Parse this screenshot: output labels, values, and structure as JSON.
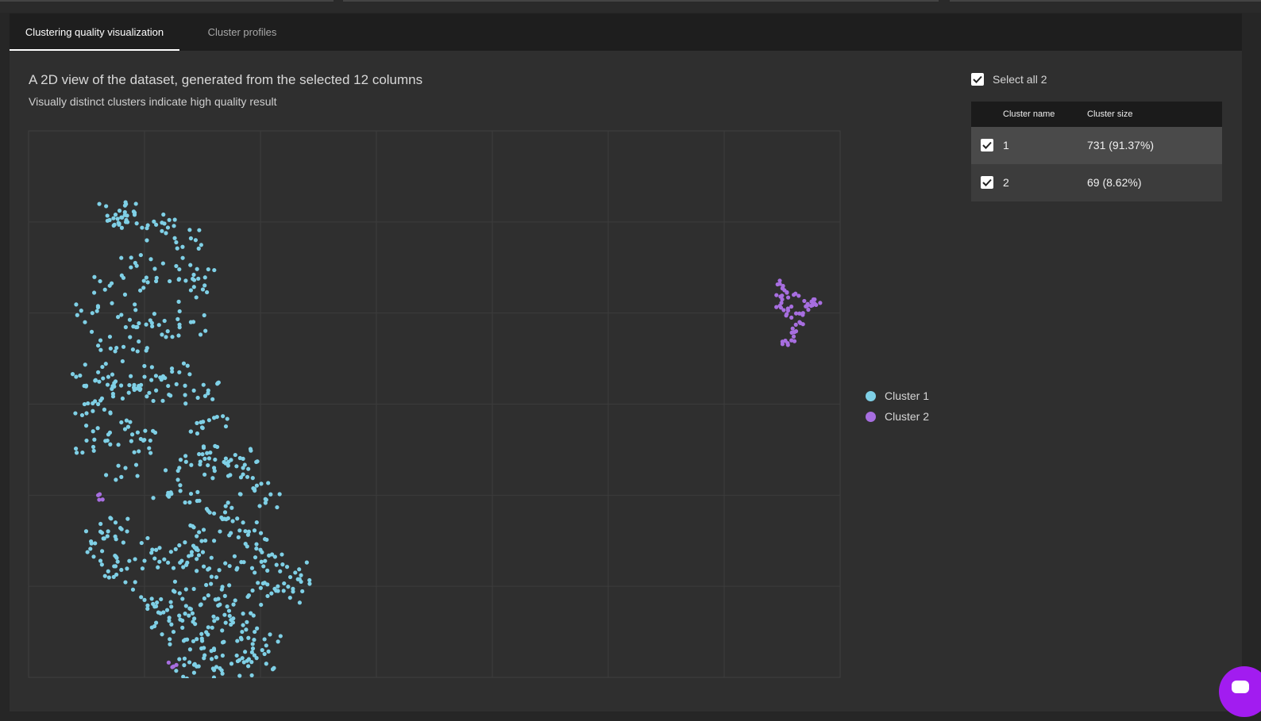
{
  "tabs": [
    {
      "label": "Clustering quality visualization",
      "active": true
    },
    {
      "label": "Cluster profiles",
      "active": false
    }
  ],
  "heading": "A 2D view of the dataset, generated from the selected 12 columns",
  "subheading": "Visually distinct clusters indicate high quality result",
  "legend": [
    {
      "label": "Cluster 1",
      "color": "#7fd0e6"
    },
    {
      "label": "Cluster 2",
      "color": "#a76ee0"
    }
  ],
  "select_all": {
    "label": "Select all 2",
    "checked": true
  },
  "cluster_table": {
    "headers": [
      "Cluster name",
      "Cluster size"
    ],
    "rows": [
      {
        "name": "1",
        "size": "731 (91.37%)",
        "checked": true
      },
      {
        "name": "2",
        "size": "69 (8.62%)",
        "checked": true
      }
    ]
  },
  "chart_data": {
    "type": "scatter",
    "grid": true,
    "xlim": [
      0,
      7
    ],
    "ylim": [
      0,
      6
    ],
    "series": [
      {
        "name": "Cluster 1",
        "color": "#7fd0e6",
        "count": 731,
        "points": [
          [
            0.75,
            5.08
          ],
          [
            0.8,
            5.05
          ],
          [
            0.85,
            5.07
          ],
          [
            0.78,
            4.97
          ],
          [
            1.1,
            4.97
          ],
          [
            1.15,
            4.9
          ],
          [
            1.4,
            4.82
          ],
          [
            0.92,
            4.55
          ],
          [
            1.3,
            4.48
          ],
          [
            1.55,
            4.48
          ],
          [
            0.7,
            4.3
          ],
          [
            1.1,
            4.35
          ],
          [
            1.4,
            4.25
          ],
          [
            0.55,
            4.0
          ],
          [
            0.8,
            3.98
          ],
          [
            1.05,
            3.92
          ],
          [
            1.2,
            3.8
          ],
          [
            1.4,
            3.9
          ],
          [
            0.62,
            3.7
          ],
          [
            0.9,
            3.6
          ],
          [
            1.0,
            3.3
          ],
          [
            1.3,
            3.35
          ],
          [
            0.48,
            3.2
          ],
          [
            0.6,
            3.35
          ],
          [
            0.75,
            3.25
          ],
          [
            0.95,
            3.2
          ],
          [
            1.1,
            3.15
          ],
          [
            1.35,
            3.1
          ],
          [
            1.55,
            3.15
          ],
          [
            0.5,
            2.9
          ],
          [
            0.6,
            3.0
          ],
          [
            0.8,
            2.8
          ],
          [
            1.6,
            2.85
          ],
          [
            1.4,
            2.7
          ],
          [
            1.52,
            2.4
          ],
          [
            1.7,
            2.35
          ],
          [
            1.85,
            2.4
          ],
          [
            0.5,
            2.6
          ],
          [
            0.68,
            2.6
          ],
          [
            0.8,
            2.2
          ],
          [
            0.99,
            2.6
          ],
          [
            1.05,
            2.6
          ],
          [
            1.3,
            2.3
          ],
          [
            1.5,
            2.45
          ],
          [
            1.6,
            2.3
          ],
          [
            1.85,
            2.3
          ],
          [
            1.95,
            2.05
          ],
          [
            2.05,
            1.95
          ],
          [
            1.2,
            2.0
          ],
          [
            1.35,
            1.92
          ],
          [
            1.6,
            1.8
          ],
          [
            1.7,
            1.88
          ],
          [
            1.85,
            1.7
          ],
          [
            0.62,
            1.6
          ],
          [
            0.68,
            1.55
          ],
          [
            0.75,
            1.7
          ],
          [
            1.3,
            1.45
          ],
          [
            1.45,
            1.55
          ],
          [
            1.6,
            1.5
          ],
          [
            1.9,
            1.6
          ],
          [
            2.0,
            1.4
          ],
          [
            2.1,
            1.35
          ],
          [
            0.62,
            1.28
          ],
          [
            0.75,
            1.22
          ],
          [
            0.8,
            1.18
          ],
          [
            1.0,
            1.28
          ],
          [
            1.1,
            1.4
          ],
          [
            1.25,
            1.2
          ],
          [
            1.45,
            1.3
          ],
          [
            1.62,
            1.1
          ],
          [
            1.8,
            1.2
          ],
          [
            1.95,
            1.15
          ],
          [
            2.15,
            1.0
          ],
          [
            2.2,
            0.95
          ],
          [
            2.35,
            1.05
          ],
          [
            2.3,
            1.15
          ],
          [
            1.0,
            0.85
          ],
          [
            1.1,
            0.78
          ],
          [
            1.25,
            0.95
          ],
          [
            1.4,
            0.75
          ],
          [
            1.55,
            0.9
          ],
          [
            1.65,
            0.8
          ],
          [
            1.85,
            0.7
          ],
          [
            1.9,
            0.9
          ],
          [
            1.1,
            0.6
          ],
          [
            1.25,
            0.5
          ],
          [
            1.45,
            0.42
          ],
          [
            1.6,
            0.3
          ],
          [
            1.8,
            0.4
          ],
          [
            1.95,
            0.5
          ],
          [
            2.05,
            0.35
          ],
          [
            1.3,
            0.2
          ],
          [
            1.45,
            0.12
          ],
          [
            1.6,
            0.08
          ],
          [
            1.75,
            0.15
          ],
          [
            1.9,
            0.2
          ],
          [
            2.05,
            0.15
          ],
          [
            1.55,
            0.55
          ],
          [
            1.7,
            0.6
          ],
          [
            1.35,
            0.7
          ]
        ]
      },
      {
        "name": "Cluster 2",
        "color": "#a76ee0",
        "count": 69,
        "points": [
          [
            6.48,
            4.32
          ],
          [
            6.52,
            4.25
          ],
          [
            6.5,
            4.15
          ],
          [
            6.55,
            4.05
          ],
          [
            6.6,
            4.2
          ],
          [
            6.48,
            4.08
          ],
          [
            6.58,
            3.95
          ],
          [
            6.72,
            4.1
          ],
          [
            6.68,
            4.0
          ],
          [
            6.65,
            3.9
          ],
          [
            6.62,
            3.8
          ],
          [
            6.58,
            3.7
          ],
          [
            6.55,
            3.65
          ],
          [
            6.78,
            4.15
          ],
          [
            6.75,
            4.08
          ],
          [
            0.6,
            2.0
          ],
          [
            1.25,
            0.12
          ]
        ]
      }
    ]
  }
}
